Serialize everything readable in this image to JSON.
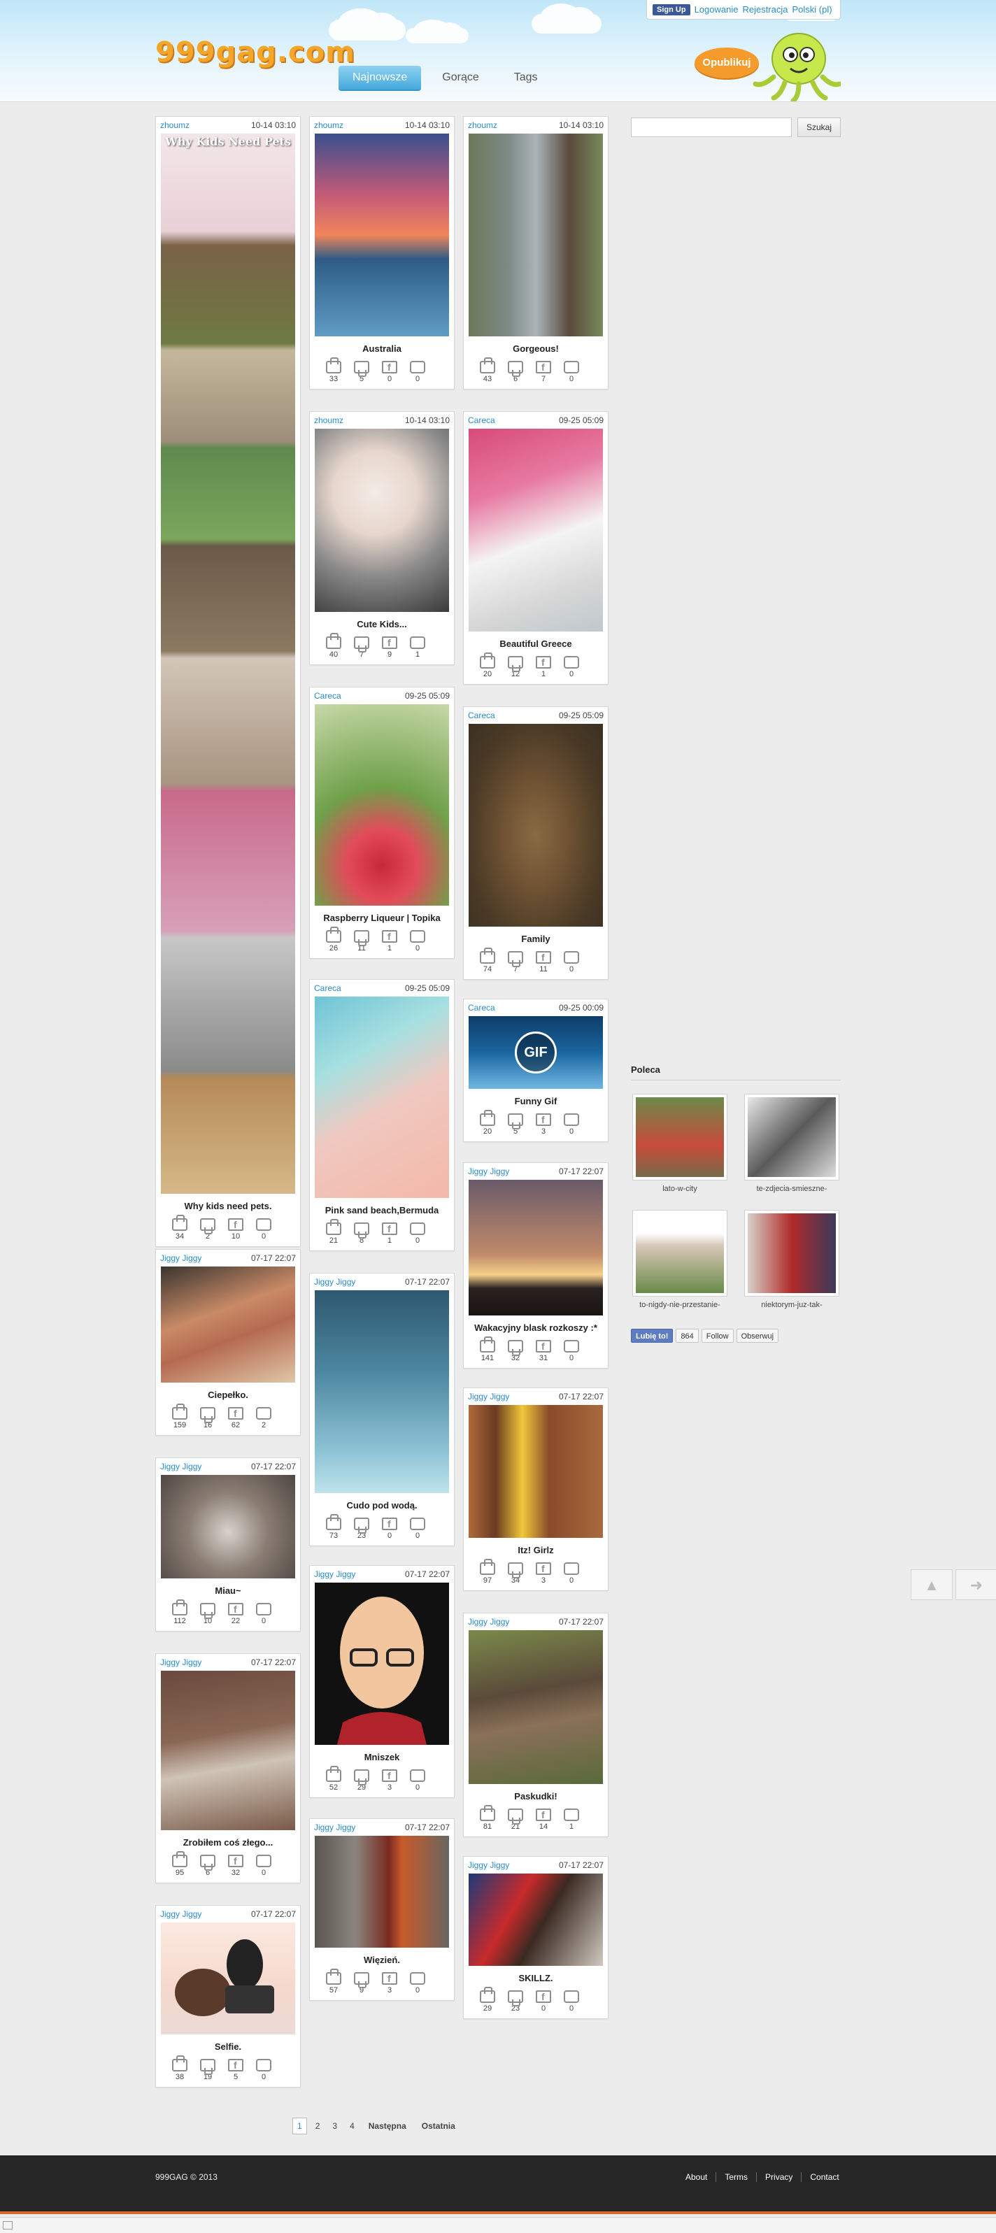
{
  "header": {
    "logo": "999gag.com",
    "nav": [
      "Najnowsze",
      "Gorące",
      "Tags"
    ],
    "active_tab": "Najnowsze",
    "top_links": {
      "signup": "Sign Up",
      "login": "Logowanie",
      "register": "Rejestracja",
      "language": "Polski (pl)"
    },
    "publish": "Opublikuj"
  },
  "posts": {
    "col1": [
      {
        "author": "zhoumz",
        "time": "10-14 03:10",
        "title": "Why kids need pets.",
        "image_caption": "Why Kids Need Pets",
        "up": "34",
        "down": "2",
        "fb": "10",
        "comments": "0"
      },
      {
        "author": "Jiggy Jiggy",
        "time": "07-17 22:07",
        "title": "Ciepełko.",
        "up": "159",
        "down": "16",
        "fb": "62",
        "comments": "2"
      },
      {
        "author": "Jiggy Jiggy",
        "time": "07-17 22:07",
        "title": "Miau~",
        "up": "112",
        "down": "10",
        "fb": "22",
        "comments": "0"
      },
      {
        "author": "Jiggy Jiggy",
        "time": "07-17 22:07",
        "title": "Zrobiłem coś złego...",
        "up": "95",
        "down": "6",
        "fb": "32",
        "comments": "0"
      },
      {
        "author": "Jiggy Jiggy",
        "time": "07-17 22:07",
        "title": "Selfie.",
        "up": "38",
        "down": "19",
        "fb": "5",
        "comments": "0"
      }
    ],
    "col2": [
      {
        "author": "zhoumz",
        "time": "10-14 03:10",
        "title": "Australia",
        "up": "33",
        "down": "5",
        "fb": "0",
        "comments": "0"
      },
      {
        "author": "zhoumz",
        "time": "10-14 03:10",
        "title": "Cute Kids...",
        "up": "40",
        "down": "7",
        "fb": "9",
        "comments": "1"
      },
      {
        "author": "Careca",
        "time": "09-25 05:09",
        "title": "Raspberry Liqueur | Topika",
        "up": "26",
        "down": "11",
        "fb": "1",
        "comments": "0"
      },
      {
        "author": "Careca",
        "time": "09-25 05:09",
        "title": "Pink sand beach,Bermuda",
        "up": "21",
        "down": "8",
        "fb": "1",
        "comments": "0"
      },
      {
        "author": "Jiggy Jiggy",
        "time": "07-17 22:07",
        "title": "Cudo pod wodą.",
        "up": "73",
        "down": "23",
        "fb": "0",
        "comments": "0"
      },
      {
        "author": "Jiggy Jiggy",
        "time": "07-17 22:07",
        "title": "Mniszek",
        "up": "52",
        "down": "29",
        "fb": "3",
        "comments": "0"
      },
      {
        "author": "Jiggy Jiggy",
        "time": "07-17 22:07",
        "title": "Więzień.",
        "up": "57",
        "down": "9",
        "fb": "3",
        "comments": "0"
      }
    ],
    "col3": [
      {
        "author": "zhoumz",
        "time": "10-14 03:10",
        "title": "Gorgeous!",
        "up": "43",
        "down": "6",
        "fb": "7",
        "comments": "0"
      },
      {
        "author": "Careca",
        "time": "09-25 05:09",
        "title": "Beautiful Greece",
        "up": "20",
        "down": "12",
        "fb": "1",
        "comments": "0"
      },
      {
        "author": "Careca",
        "time": "09-25 05:09",
        "title": "Family",
        "up": "74",
        "down": "7",
        "fb": "11",
        "comments": "0"
      },
      {
        "author": "Careca",
        "time": "09-25 00:09",
        "title": "Funny Gif",
        "image_caption": "GIF",
        "up": "20",
        "down": "5",
        "fb": "3",
        "comments": "0"
      },
      {
        "author": "Jiggy Jiggy",
        "time": "07-17 22:07",
        "title": "Wakacyjny blask rozkoszy :*",
        "up": "141",
        "down": "32",
        "fb": "31",
        "comments": "0"
      },
      {
        "author": "Jiggy Jiggy",
        "time": "07-17 22:07",
        "title": "Itz! Girlz",
        "up": "97",
        "down": "34",
        "fb": "3",
        "comments": "0"
      },
      {
        "author": "Jiggy Jiggy",
        "time": "07-17 22:07",
        "title": "Paskudki!",
        "up": "81",
        "down": "21",
        "fb": "14",
        "comments": "1"
      },
      {
        "author": "Jiggy Jiggy",
        "time": "07-17 22:07",
        "title": "SKILLZ.",
        "up": "29",
        "down": "23",
        "fb": "0",
        "comments": "0"
      }
    ]
  },
  "sidebar": {
    "search_button": "Szukaj",
    "recommend_title": "Poleca",
    "recommended": [
      "lato-w-city",
      "te-zdjecia-smieszne-",
      "to-nigdy-nie-przestanie-",
      "niektorym-juz-tak-"
    ],
    "social": {
      "like": "Lubię to!",
      "like_count": "864",
      "follow": "Follow",
      "observe": "Obserwuj"
    }
  },
  "pagination": {
    "pages": [
      "1",
      "2",
      "3",
      "4"
    ],
    "next": "Następna",
    "last": "Ostatnia"
  },
  "footer": {
    "copyright": "999GAG © 2013",
    "links": [
      "About",
      "Terms",
      "Privacy",
      "Contact"
    ]
  },
  "colors": {
    "accent": "#2a8bc8",
    "logo": "#f4a62a",
    "publish": "#f49b2c",
    "footer_bg": "#262626"
  },
  "icons": [
    "thumb-up-icon",
    "thumb-down-icon",
    "facebook-share-icon",
    "comment-icon",
    "scroll-up-icon",
    "next-arrow-icon"
  ]
}
